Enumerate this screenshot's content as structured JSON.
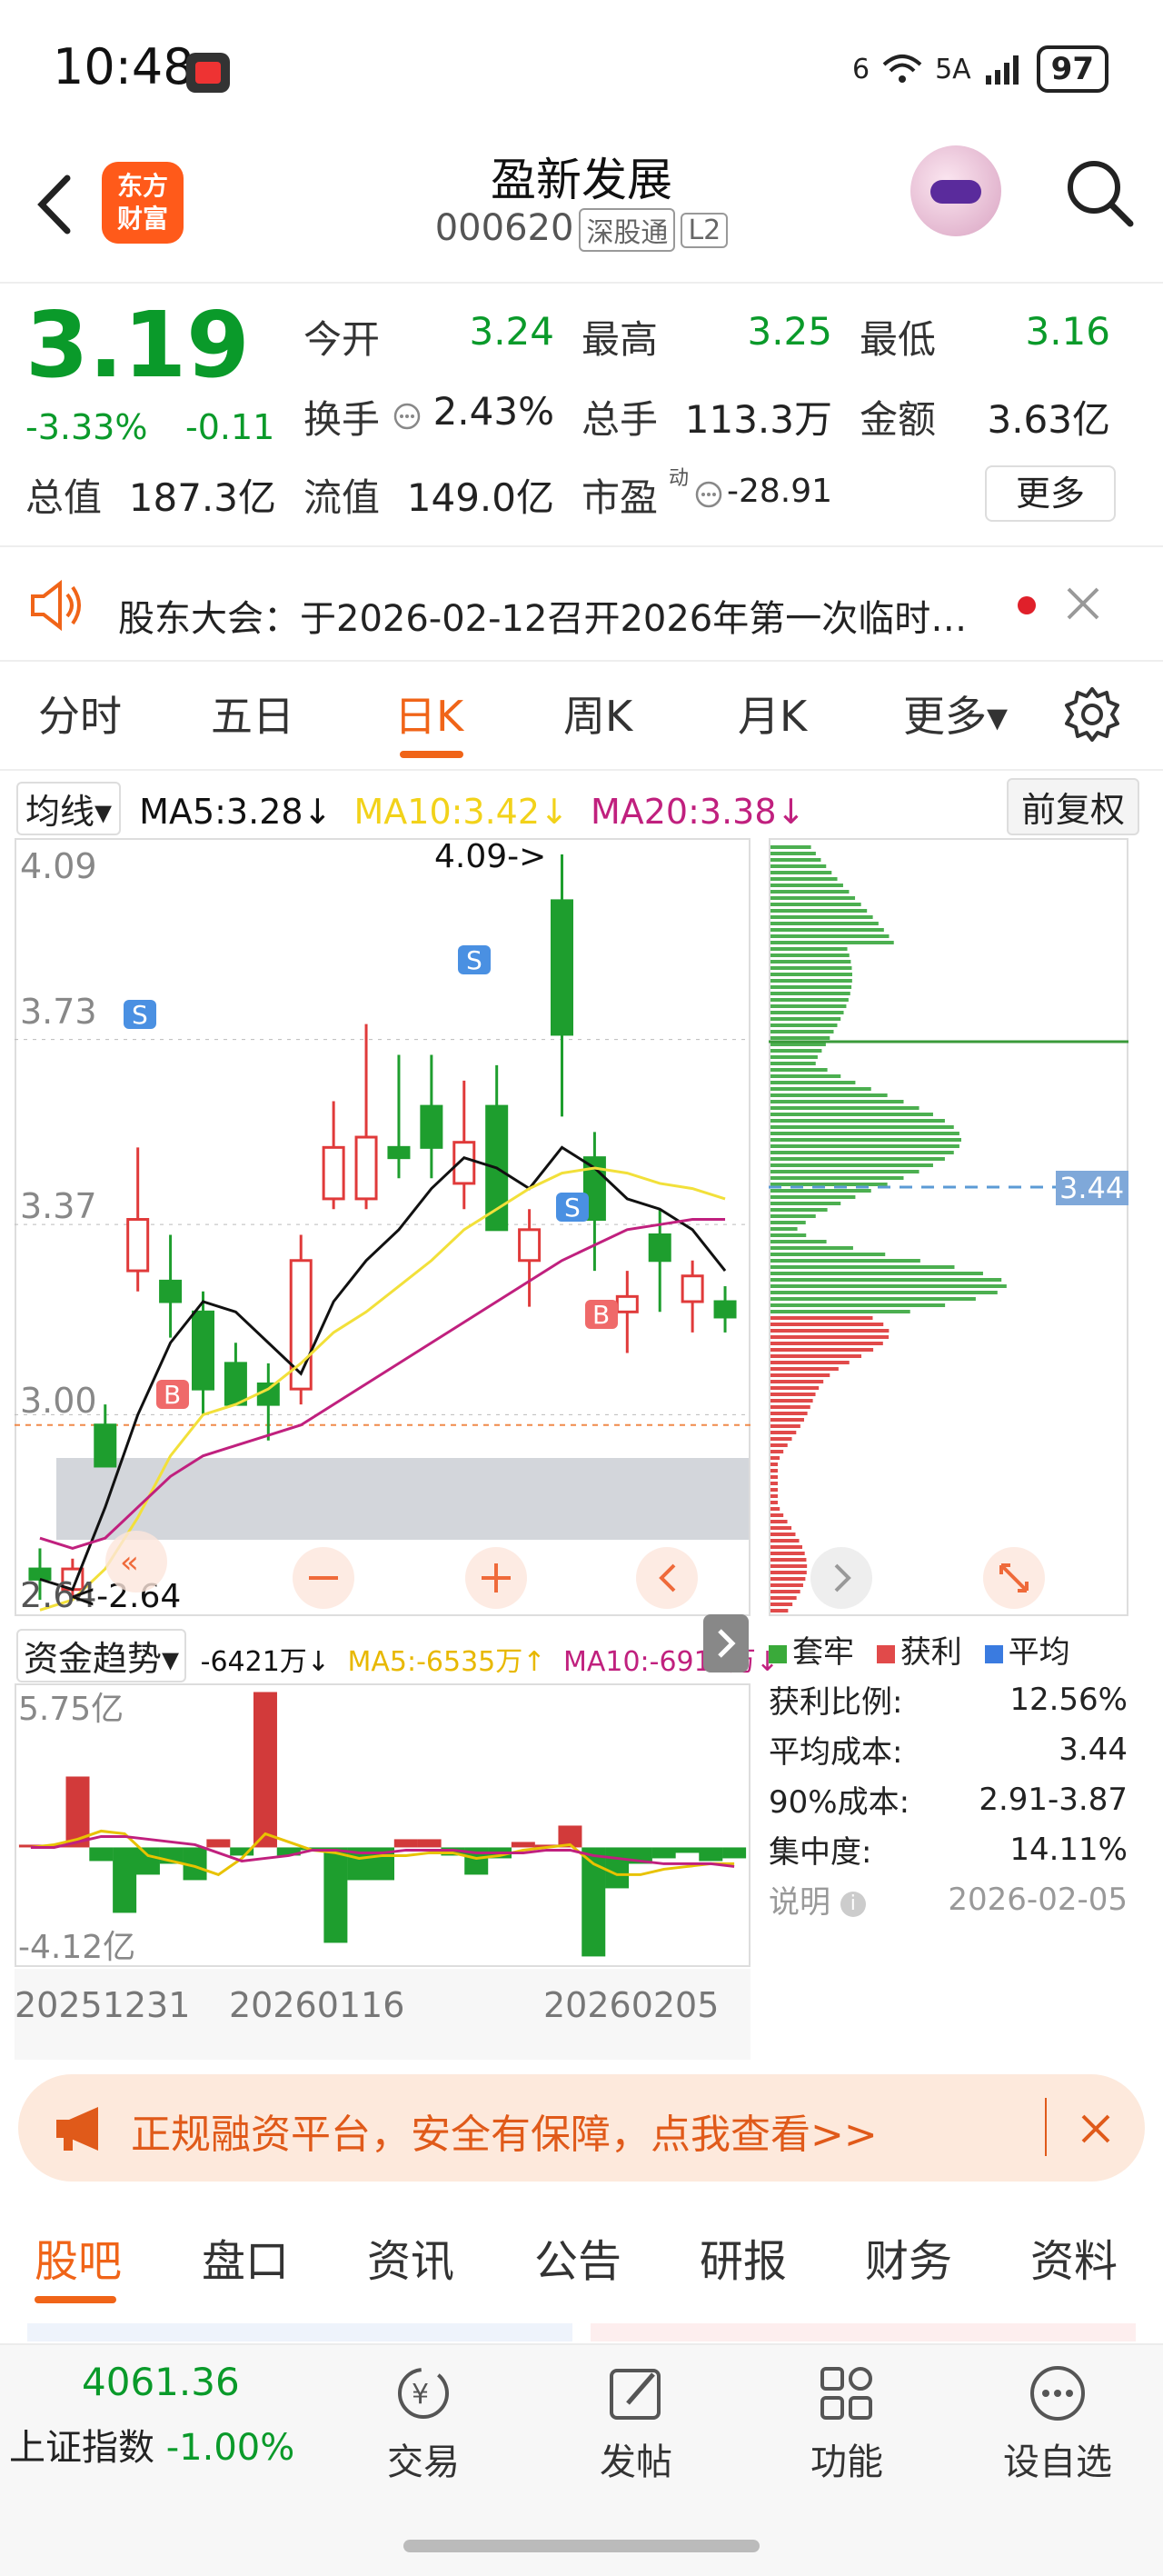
{
  "status_bar": {
    "time": "10:48",
    "network": "6",
    "signal_label": "5A",
    "battery": "97"
  },
  "header": {
    "logo_line1": "东方",
    "logo_line2": "财富",
    "stock_name": "盈新发展",
    "stock_code": "000620",
    "tag1": "深股通",
    "tag2": "L2"
  },
  "quote": {
    "price": "3.19",
    "change_pct": "-3.33%",
    "change": "-0.11",
    "open_label": "今开",
    "open": "3.24",
    "high_label": "最高",
    "high": "3.25",
    "low_label": "最低",
    "low": "3.16",
    "turnover_label": "换手",
    "turnover": "2.43%",
    "volume_label": "总手",
    "volume": "113.3万",
    "amount_label": "金额",
    "amount": "3.63亿",
    "mcap_label": "总值",
    "mcap": "187.3亿",
    "float_label": "流值",
    "float": "149.0亿",
    "pe_label": "市盈",
    "pe_sup": "动",
    "pe": "-28.91",
    "more": "更多"
  },
  "notice": {
    "text": "股东大会：于2026-02-12召开2026年第一次临时…"
  },
  "chart_tabs": [
    "分时",
    "五日",
    "日K",
    "周K",
    "月K",
    "更多▾"
  ],
  "ma": {
    "selector": "均线▾",
    "ma5": "MA5:3.28↓",
    "ma10": "MA10:3.42↓",
    "ma20": "MA20:3.38↓",
    "adjust": "前复权"
  },
  "kline_labels": {
    "y_top": "4.09",
    "y2": "3.73",
    "y3": "3.37",
    "y4": "3.00",
    "y_bottom": "2.64",
    "high_marker": "4.09->",
    "low_marker": "<-2.64",
    "price_marker": "3.44",
    "sig_b": "B",
    "sig_s": "S"
  },
  "indicator": {
    "selector": "资金趋势▾",
    "value": "-6421万↓",
    "ma5": "MA5:-6535万↑",
    "ma10": "MA10:-6912万↓",
    "y_top": "5.75亿",
    "y_bottom": "-4.12亿"
  },
  "dates": [
    "20251231",
    "20260116",
    "20260205"
  ],
  "chip": {
    "legend": [
      "套牢",
      "获利",
      "平均"
    ],
    "rows": [
      {
        "label": "获利比例:",
        "value": "12.56%"
      },
      {
        "label": "平均成本:",
        "value": "3.44"
      },
      {
        "label": "90%成本:",
        "value": "2.91-3.87"
      },
      {
        "label": "集中度:",
        "value": "14.11%"
      }
    ],
    "note_label": "说明",
    "note_date": "2026-02-05"
  },
  "ad": {
    "text": "正规融资平台，安全有保障，点我查看>>"
  },
  "bottom_tabs": [
    "股吧",
    "盘口",
    "资讯",
    "公告",
    "研报",
    "财务",
    "资料"
  ],
  "bottom_bar": {
    "index_value": "4061.36",
    "index_name": "上证指数",
    "index_change": "-1.00%",
    "trade": "交易",
    "post": "发帖",
    "func": "功能",
    "watch": "设自选"
  },
  "chart_data": [
    {
      "type": "candlestick",
      "ylim": [
        2.64,
        4.09
      ],
      "y_ticks": [
        "4.09",
        "3.73",
        "3.37",
        "3.00"
      ],
      "ohlc": [
        {
          "o": 2.7,
          "h": 2.74,
          "l": 2.64,
          "c": 2.68
        },
        {
          "o": 2.66,
          "h": 2.72,
          "l": 2.64,
          "c": 2.7
        },
        {
          "o": 2.98,
          "h": 3.02,
          "l": 2.96,
          "c": 2.9
        },
        {
          "o": 3.28,
          "h": 3.52,
          "l": 3.24,
          "c": 3.38
        },
        {
          "o": 3.26,
          "h": 3.35,
          "l": 3.15,
          "c": 3.22
        },
        {
          "o": 3.2,
          "h": 3.24,
          "l": 3.0,
          "c": 3.05
        },
        {
          "o": 3.1,
          "h": 3.14,
          "l": 3.02,
          "c": 3.02
        },
        {
          "o": 3.06,
          "h": 3.1,
          "l": 2.95,
          "c": 3.02
        },
        {
          "o": 3.05,
          "h": 3.35,
          "l": 3.02,
          "c": 3.3
        },
        {
          "o": 3.42,
          "h": 3.61,
          "l": 3.4,
          "c": 3.52
        },
        {
          "o": 3.42,
          "h": 3.76,
          "l": 3.4,
          "c": 3.54
        },
        {
          "o": 3.52,
          "h": 3.7,
          "l": 3.46,
          "c": 3.5
        },
        {
          "o": 3.6,
          "h": 3.7,
          "l": 3.46,
          "c": 3.52
        },
        {
          "o": 3.45,
          "h": 3.65,
          "l": 3.4,
          "c": 3.53
        },
        {
          "o": 3.6,
          "h": 3.68,
          "l": 3.42,
          "c": 3.36
        },
        {
          "o": 3.3,
          "h": 3.4,
          "l": 3.21,
          "c": 3.36
        },
        {
          "o": 4.0,
          "h": 4.09,
          "l": 3.58,
          "c": 3.74
        },
        {
          "o": 3.5,
          "h": 3.55,
          "l": 3.28,
          "c": 3.38
        },
        {
          "o": 3.2,
          "h": 3.28,
          "l": 3.12,
          "c": 3.23
        },
        {
          "o": 3.35,
          "h": 3.4,
          "l": 3.2,
          "c": 3.3
        },
        {
          "o": 3.22,
          "h": 3.3,
          "l": 3.16,
          "c": 3.27
        },
        {
          "o": 3.22,
          "h": 3.25,
          "l": 3.16,
          "c": 3.19
        }
      ],
      "ma5": [
        2.68,
        2.66,
        2.82,
        3.0,
        3.14,
        3.22,
        3.2,
        3.14,
        3.08,
        3.22,
        3.3,
        3.36,
        3.44,
        3.5,
        3.48,
        3.44,
        3.52,
        3.48,
        3.42,
        3.4,
        3.36,
        3.28
      ],
      "ma10": [
        2.62,
        2.64,
        2.7,
        2.8,
        2.92,
        3.0,
        3.02,
        3.05,
        3.1,
        3.16,
        3.2,
        3.25,
        3.3,
        3.36,
        3.4,
        3.44,
        3.47,
        3.48,
        3.47,
        3.45,
        3.44,
        3.42
      ],
      "ma20": [
        2.76,
        2.74,
        2.76,
        2.82,
        2.88,
        2.92,
        2.94,
        2.96,
        2.98,
        3.02,
        3.06,
        3.1,
        3.14,
        3.18,
        3.22,
        3.26,
        3.3,
        3.33,
        3.36,
        3.37,
        3.38,
        3.38
      ]
    },
    {
      "type": "bar",
      "name": "资金趋势",
      "ylim": [
        -4.12,
        5.75
      ],
      "values": [
        0.1,
        0.1,
        2.6,
        -0.5,
        -2.4,
        -1.0,
        -0.6,
        -1.2,
        0.3,
        -0.3,
        5.7,
        -0.3,
        -0.1,
        -3.5,
        -1.2,
        -1.2,
        0.3,
        0.3,
        -0.3,
        -1.0,
        -0.4,
        0.2,
        0.1,
        0.8,
        -4.0,
        -1.5,
        -0.6,
        -0.4,
        -0.2,
        -0.5,
        -0.4
      ],
      "ma5": [
        0.0,
        0.1,
        0.3,
        0.6,
        0.5,
        -0.3,
        -0.5,
        -0.7,
        -1.0,
        -0.4,
        0.5,
        0.2,
        -0.1,
        -0.2,
        -0.4,
        -0.3,
        -0.3,
        -0.2,
        -0.2,
        -0.4,
        -0.3,
        -0.1,
        0.0,
        0.1,
        -0.6,
        -1.0,
        -1.0,
        -0.8,
        -0.7,
        -0.6,
        -0.6
      ],
      "ma10": [
        0.0,
        0.0,
        0.2,
        0.4,
        0.4,
        0.3,
        0.2,
        0.1,
        -0.2,
        -0.5,
        -0.4,
        -0.3,
        -0.1,
        -0.1,
        -0.2,
        -0.2,
        -0.1,
        -0.1,
        -0.1,
        -0.2,
        -0.2,
        -0.2,
        -0.1,
        -0.1,
        -0.3,
        -0.4,
        -0.5,
        -0.6,
        -0.6,
        -0.6,
        -0.7
      ]
    }
  ]
}
